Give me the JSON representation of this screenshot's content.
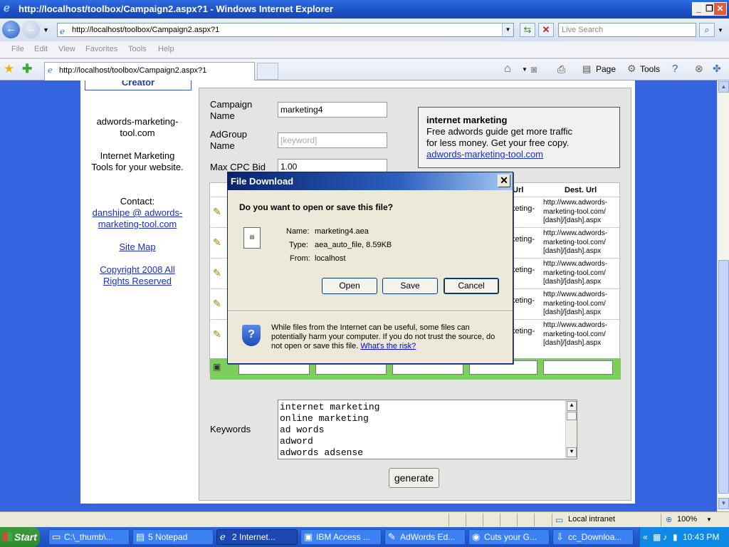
{
  "window": {
    "title": "http://localhost/toolbox/Campaign2.aspx?1 - Windows Internet Explorer"
  },
  "addressbar": {
    "url": "http://localhost/toolbox/Campaign2.aspx?1",
    "search_placeholder": "Live Search"
  },
  "menu": [
    "File",
    "Edit",
    "View",
    "Favorites",
    "Tools",
    "Help"
  ],
  "tab": {
    "label": "http://localhost/toolbox/Campaign2.aspx?1"
  },
  "commandbar": {
    "page": "Page",
    "tools": "Tools"
  },
  "sidebar": {
    "header": "Creator",
    "site": "adwords-marketing-tool.com",
    "tagline": "Internet Marketing Tools for your website.",
    "contact_label": "Contact:",
    "contact_email": "danshipe @ adwords-marketing-tool.com",
    "sitemap": "Site Map",
    "copyright": "Copyright 2008 All Rights Reserved"
  },
  "form": {
    "campaign_label": "Campaign Name",
    "campaign_value": "marketing4",
    "adgroup_label": "AdGroup Name",
    "adgroup_placeholder": "[keyword]",
    "maxcpc_label": "Max CPC Bid",
    "maxcpc_value": "1.00",
    "keywords_label": "Keywords",
    "keywords": [
      "internet marketing",
      "online marketing",
      "ad words",
      "adword",
      "adwords adsense"
    ],
    "generate": "generate"
  },
  "ad_preview": {
    "headline": "internet marketing",
    "line1": "Free adwords guide get more traffic",
    "line2": "for less money. Get your free copy.",
    "url": "adwords-marketing-tool.com"
  },
  "grid": {
    "header_url": "Url",
    "header_dest": "Dest. Url",
    "rows": [
      {
        "cell": "keting-",
        "dest": [
          "http://www.adwords-",
          "marketing-tool.com/",
          "[dash]/[dash].aspx"
        ]
      },
      {
        "cell": "keting-",
        "dest": [
          "http://www.adwords-",
          "marketing-tool.com/",
          "[dash]/[dash].aspx"
        ]
      },
      {
        "cell": "keting-",
        "dest": [
          "http://www.adwords-",
          "marketing-tool.com/",
          "[dash]/[dash].aspx"
        ]
      },
      {
        "cell": "keting-",
        "dest": [
          "http://www.adwords-",
          "marketing-tool.com/",
          "[dash]/[dash].aspx"
        ]
      },
      {
        "cell": "keting-",
        "dest": [
          "http://www.adwords-",
          "marketing-tool.com/",
          "[dash]/[dash].aspx"
        ]
      }
    ]
  },
  "dialog": {
    "title": "File Download",
    "question": "Do you want to open or save this file?",
    "name_label": "Name:",
    "name_value": "marketing4.aea",
    "type_label": "Type:",
    "type_value": "aea_auto_file, 8.59KB",
    "from_label": "From:",
    "from_value": "localhost",
    "open": "Open",
    "save": "Save",
    "cancel": "Cancel",
    "warning": "While files from the Internet can be useful, some files can potentially harm your computer. If you do not trust the source, do not open or save this file.",
    "risk_link": "What's the risk?"
  },
  "statusbar": {
    "zone": "Local intranet",
    "zoom": "100%"
  },
  "taskbar": {
    "start": "Start",
    "items": [
      {
        "label": "C:\\_thumb\\..."
      },
      {
        "label": "5 Notepad"
      },
      {
        "label": "2 Internet..."
      },
      {
        "label": "IBM Access ..."
      },
      {
        "label": "AdWords Ed..."
      },
      {
        "label": "Cuts your G..."
      },
      {
        "label": "cc_Downloa..."
      }
    ],
    "clock": "10:43 PM"
  }
}
